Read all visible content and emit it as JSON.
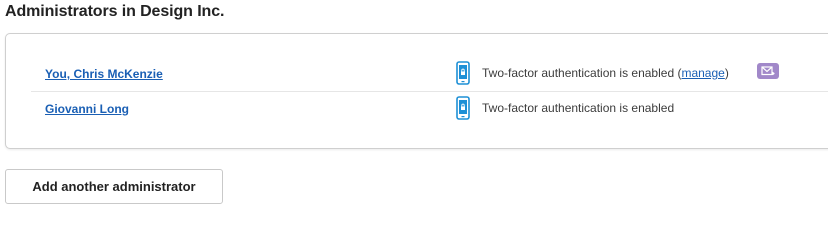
{
  "page": {
    "title": "Administrators in Design Inc."
  },
  "administrators": [
    {
      "name": "You, Chris McKenzie",
      "device_icon": "phone-lock-icon",
      "status_text": "Two-factor authentication is enabled (",
      "manage_label": "manage",
      "status_suffix": ")",
      "action_icon": "envelope-icon"
    },
    {
      "name": "Giovanni Long",
      "device_icon": "phone-lock-icon",
      "status_text": "Two-factor authentication is enabled"
    }
  ],
  "actions": {
    "add_admin_label": "Add another administrator"
  },
  "colors": {
    "link": "#1a5fb4",
    "device_icon": "#1e90d6",
    "mail_button": "#a188c9"
  }
}
